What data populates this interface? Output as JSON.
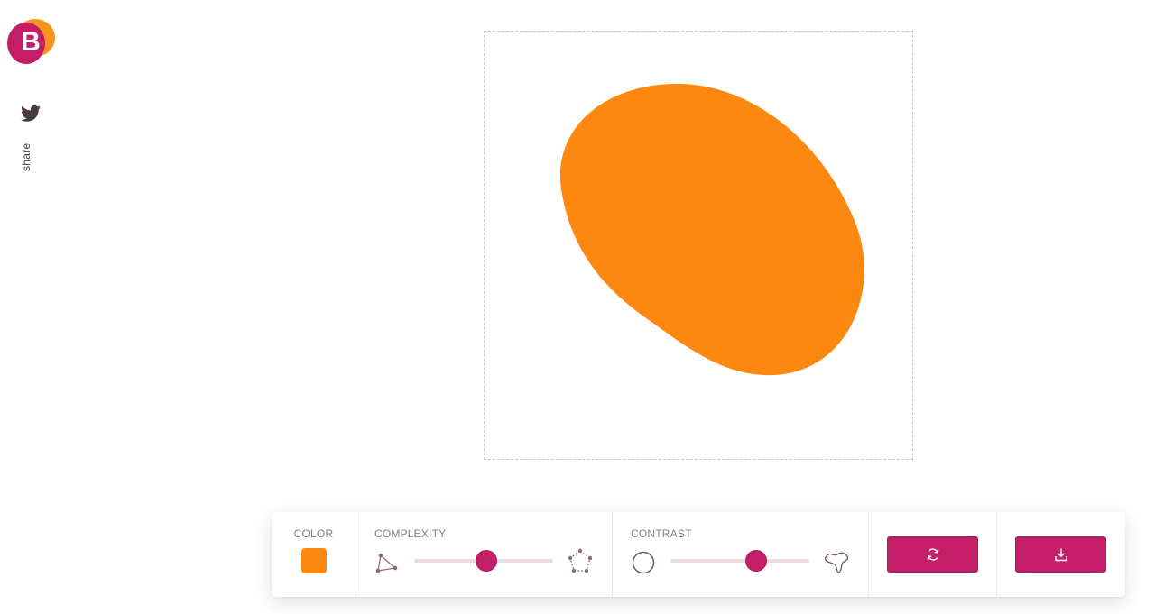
{
  "app": {
    "logo_letter": "B"
  },
  "sidebar": {
    "share_label": "share",
    "share_icon": "twitter-icon"
  },
  "blob": {
    "color": "#fd8810",
    "complexity": 0.52,
    "contrast": 0.62
  },
  "toolbar": {
    "color_label": "COLOR",
    "complexity_label": "COMPLEXITY",
    "contrast_label": "CONTRAST",
    "randomize_icon": "refresh-icon",
    "download_icon": "download-icon"
  },
  "colors": {
    "accent": "#c51e69",
    "logo_orange": "#f7941d"
  }
}
